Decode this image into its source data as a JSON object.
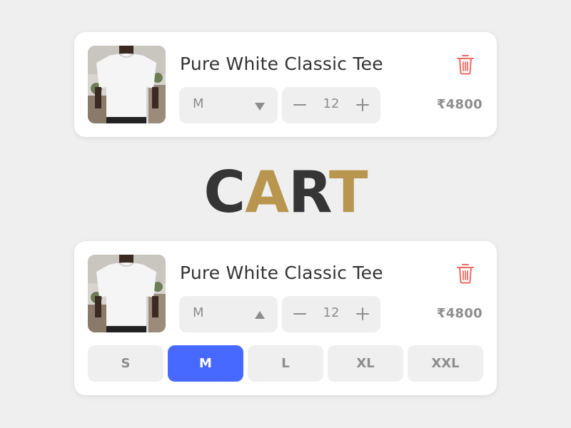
{
  "heading": {
    "letters": [
      "C",
      "A",
      "R",
      "T"
    ],
    "colors": [
      "#353535",
      "#b8964f",
      "#353535",
      "#b8964f"
    ]
  },
  "cart_items": [
    {
      "title": "Pure White Classic Tee",
      "size": "M",
      "size_caret": "down",
      "quantity": "12",
      "price": "₹4800",
      "decrement_icon": "minus-icon",
      "increment_icon": "plus-icon",
      "delete_icon": "trash-icon"
    },
    {
      "title": "Pure White Classic Tee",
      "size": "M",
      "size_caret": "up",
      "quantity": "12",
      "price": "₹4800",
      "decrement_icon": "minus-icon",
      "increment_icon": "plus-icon",
      "delete_icon": "trash-icon",
      "size_options": [
        "S",
        "M",
        "L",
        "XL",
        "XXL"
      ],
      "selected_size": "M"
    }
  ],
  "colors": {
    "background": "#efefef",
    "card": "#ffffff",
    "control": "#efefef",
    "muted_text": "#8d8d8d",
    "title_text": "#333333",
    "accent_blue": "#4869ff",
    "delete_red": "#ec6a62"
  }
}
